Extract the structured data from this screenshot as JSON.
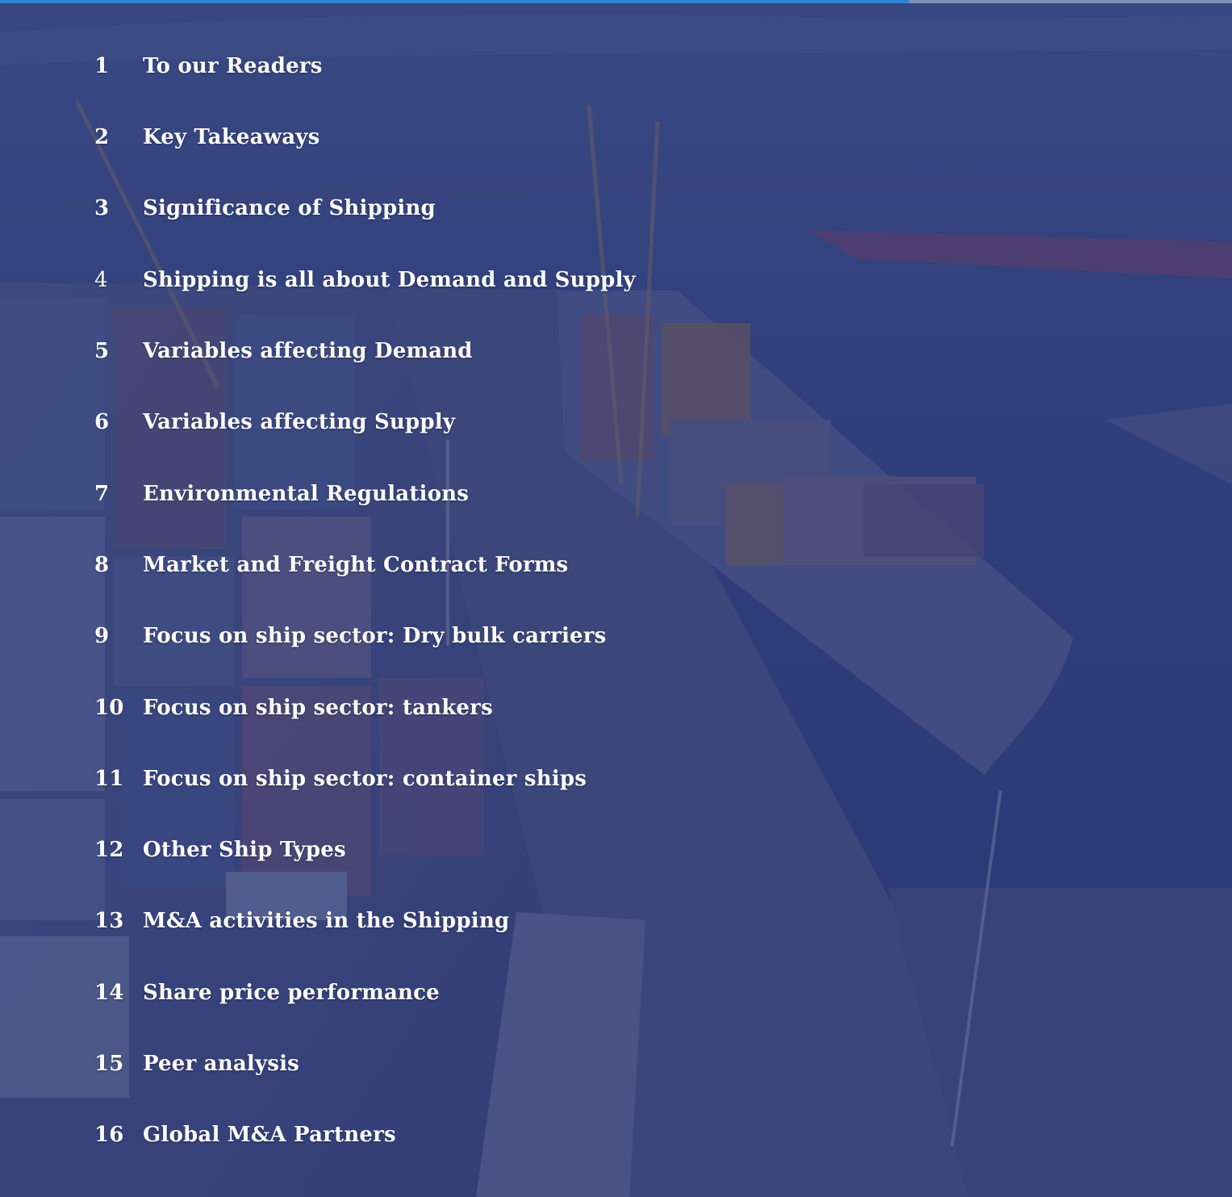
{
  "colors": {
    "overlay": "#2c3a6e",
    "accent_bar": "#2f86d6",
    "text": "#ffffff"
  },
  "toc": [
    {
      "num": "1",
      "title": "To our Readers"
    },
    {
      "num": "2",
      "title": "Key Takeaways"
    },
    {
      "num": "3",
      "title": "Significance of Shipping"
    },
    {
      "num": "4",
      "title": "Shipping is all about Demand and Supply"
    },
    {
      "num": "5",
      "title": "Variables affecting Demand"
    },
    {
      "num": "6",
      "title": "Variables affecting Supply"
    },
    {
      "num": "7",
      "title": "Environmental Regulations"
    },
    {
      "num": "8",
      "title": "Market and Freight Contract Forms"
    },
    {
      "num": "9",
      "title": "Focus on ship sector: Dry bulk carriers"
    },
    {
      "num": "10",
      "title": "Focus on ship sector: tankers"
    },
    {
      "num": "11",
      "title": "Focus on ship sector: container ships"
    },
    {
      "num": "12",
      "title": "Other Ship Types"
    },
    {
      "num": "13",
      "title": "M&A activities in the Shipping"
    },
    {
      "num": "14",
      "title": "Share price performance"
    },
    {
      "num": "15",
      "title": "Peer analysis"
    },
    {
      "num": "16",
      "title": "Global M&A Partners"
    }
  ]
}
